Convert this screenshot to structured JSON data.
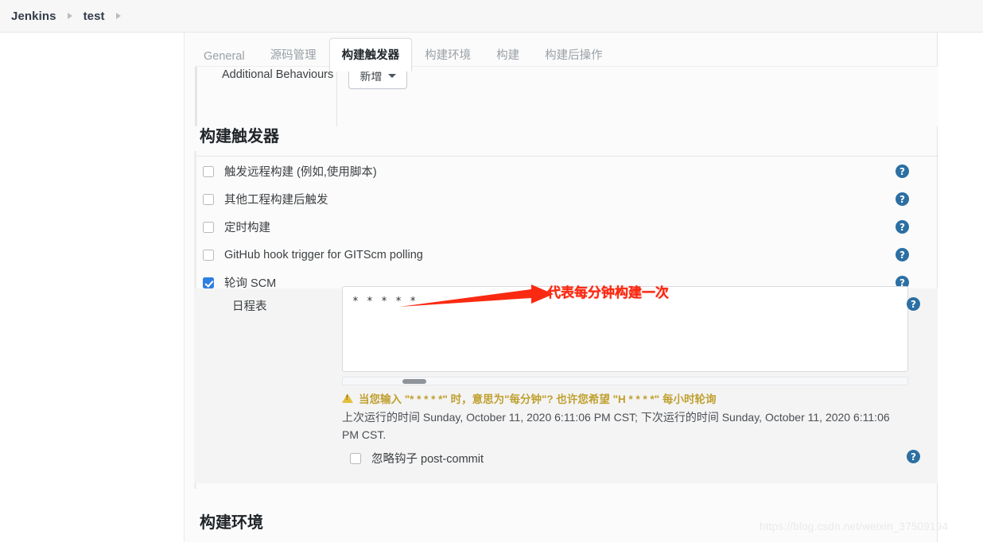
{
  "breadcrumb": {
    "items": [
      {
        "label": "Jenkins"
      },
      {
        "label": "test"
      }
    ]
  },
  "tabs": [
    {
      "label": "General",
      "active": false
    },
    {
      "label": "源码管理",
      "active": false
    },
    {
      "label": "构建触发器",
      "active": true
    },
    {
      "label": "构建环境",
      "active": false
    },
    {
      "label": "构建",
      "active": false
    },
    {
      "label": "构建后操作",
      "active": false
    }
  ],
  "top_partial_row": {
    "label": "Additional Behaviours",
    "add_button_label": "新增"
  },
  "sections": {
    "build_triggers_title": "构建触发器",
    "build_environment_title": "构建环境"
  },
  "triggers": [
    {
      "label": "触发远程构建 (例如,使用脚本)",
      "checked": false,
      "help": "?"
    },
    {
      "label": "其他工程构建后触发",
      "checked": false,
      "help": "?"
    },
    {
      "label": "定时构建",
      "checked": false,
      "help": "?"
    },
    {
      "label": "GitHub hook trigger for GITScm polling",
      "checked": false,
      "help": "?"
    },
    {
      "label": "轮询 SCM",
      "checked": true,
      "help": "?"
    }
  ],
  "schedule": {
    "label": "日程表",
    "value": "* * * * *",
    "placeholder": "",
    "help": "?",
    "warning": "当您输入 \"* * * * *\" 时，意思为\"每分钟\"? 也许您希望 \"H * * * *\" 每小时轮询",
    "run_times": "上次运行的时间 Sunday, October 11, 2020 6:11:06 PM CST; 下次运行的时间 Sunday, October 11, 2020 6:11:06 PM CST.",
    "ignore_hook": {
      "label": "忽略钩子 post-commit",
      "checked": false,
      "help": "?"
    }
  },
  "annotation": {
    "text": "代表每分钟构建一次",
    "color": "#fa2a12"
  },
  "watermark": {
    "text": "https://blog.csdn.net/weixin_37509194"
  },
  "colors": {
    "accent_checkbox": "#2f7fe0",
    "help_icon": "#2c6fa3",
    "warning": "#c0a030",
    "annotation_red": "#fa2a12"
  }
}
